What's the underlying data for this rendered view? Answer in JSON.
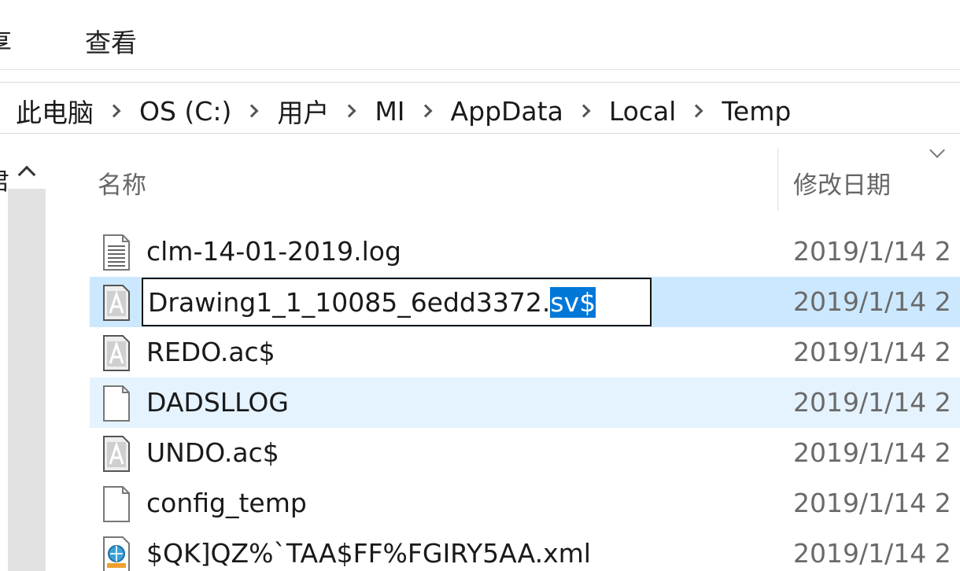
{
  "ribbon": {
    "tabs": [
      {
        "label": "享"
      },
      {
        "label": "查看"
      }
    ]
  },
  "address": {
    "crumbs": [
      "此电脑",
      "OS (C:)",
      "用户",
      "MI",
      "AppData",
      "Local",
      "Temp"
    ]
  },
  "nav": {
    "label": "君"
  },
  "columns": {
    "name": "名称",
    "date": "修改日期"
  },
  "rename": {
    "base": "Drawing1_1_10085_6edd3372.",
    "selected": "sv$"
  },
  "files": [
    {
      "name": "clm-14-01-2019.log",
      "date": "2019/1/14 2",
      "icon": "text-document-icon",
      "state": "normal"
    },
    {
      "name": "Drawing1_1_10085_6edd3372.sv$",
      "date": "2019/1/14 2",
      "icon": "autocad-file-icon",
      "state": "selected"
    },
    {
      "name": "REDO.ac$",
      "date": "2019/1/14 2",
      "icon": "autocad-file-icon",
      "state": "normal"
    },
    {
      "name": "DADSLLOG",
      "date": "2019/1/14 2",
      "icon": "blank-file-icon",
      "state": "hover"
    },
    {
      "name": "UNDO.ac$",
      "date": "2019/1/14 2",
      "icon": "autocad-file-icon",
      "state": "normal"
    },
    {
      "name": "config_temp",
      "date": "2019/1/14 2",
      "icon": "blank-file-icon",
      "state": "normal"
    },
    {
      "name": "$QK]QZ%`TAA$FF%FGIRY5AA.xml",
      "date": "2019/1/14 2",
      "icon": "xml-file-icon",
      "state": "normal"
    }
  ],
  "colors": {
    "selected_row": "#cce8ff",
    "hover_row": "#e5f3ff",
    "text_selection": "#0078d7"
  }
}
